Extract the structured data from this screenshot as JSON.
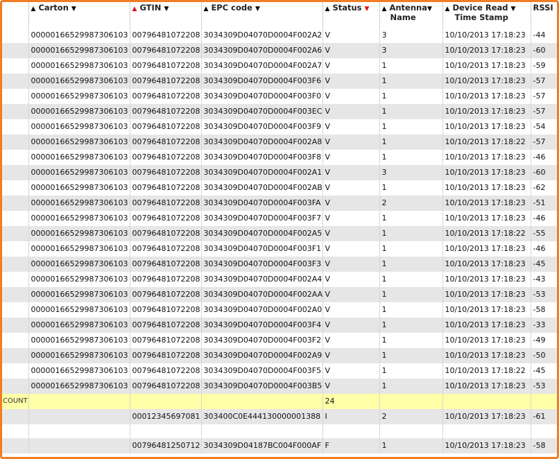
{
  "headers": {
    "carton": "Carton",
    "gtin": "GTIN",
    "epc": "EPC code",
    "status": "Status",
    "antenna_line1": "Antenna",
    "antenna_line2": "Name",
    "device_line1": "Device Read",
    "device_line2": "Time Stamp",
    "rssi": "RSSI"
  },
  "sort_indicators": {
    "up": "▲",
    "down": "▼",
    "active_color": "#d8141c"
  },
  "rows": [
    {
      "carton": "00000166529987306103",
      "gtin": "00796481072208",
      "epc": "3034309D04070D0004F002A2",
      "status": "V",
      "antenna": "3",
      "time": "10/10/2013 17:18:23",
      "rssi": "-44"
    },
    {
      "carton": "00000166529987306103",
      "gtin": "00796481072208",
      "epc": "3034309D04070D0004F002A6",
      "status": "V",
      "antenna": "3",
      "time": "10/10/2013 17:18:23",
      "rssi": "-60"
    },
    {
      "carton": "00000166529987306103",
      "gtin": "00796481072208",
      "epc": "3034309D04070D0004F002A7",
      "status": "V",
      "antenna": "1",
      "time": "10/10/2013 17:18:23",
      "rssi": "-59"
    },
    {
      "carton": "00000166529987306103",
      "gtin": "00796481072208",
      "epc": "3034309D04070D0004F003F6",
      "status": "V",
      "antenna": "1",
      "time": "10/10/2013 17:18:23",
      "rssi": "-57"
    },
    {
      "carton": "00000166529987306103",
      "gtin": "00796481072208",
      "epc": "3034309D04070D0004F003F0",
      "status": "V",
      "antenna": "1",
      "time": "10/10/2013 17:18:23",
      "rssi": "-57"
    },
    {
      "carton": "00000166529987306103",
      "gtin": "00796481072208",
      "epc": "3034309D04070D0004F003EC",
      "status": "V",
      "antenna": "1",
      "time": "10/10/2013 17:18:23",
      "rssi": "-57"
    },
    {
      "carton": "00000166529987306103",
      "gtin": "00796481072208",
      "epc": "3034309D04070D0004F003F9",
      "status": "V",
      "antenna": "1",
      "time": "10/10/2013 17:18:23",
      "rssi": "-54"
    },
    {
      "carton": "00000166529987306103",
      "gtin": "00796481072208",
      "epc": "3034309D04070D0004F002A8",
      "status": "V",
      "antenna": "1",
      "time": "10/10/2013 17:18:22",
      "rssi": "-57"
    },
    {
      "carton": "00000166529987306103",
      "gtin": "00796481072208",
      "epc": "3034309D04070D0004F003F8",
      "status": "V",
      "antenna": "1",
      "time": "10/10/2013 17:18:23",
      "rssi": "-46"
    },
    {
      "carton": "00000166529987306103",
      "gtin": "00796481072208",
      "epc": "3034309D04070D0004F002A1",
      "status": "V",
      "antenna": "3",
      "time": "10/10/2013 17:18:23",
      "rssi": "-60"
    },
    {
      "carton": "00000166529987306103",
      "gtin": "00796481072208",
      "epc": "3034309D04070D0004F002AB",
      "status": "V",
      "antenna": "1",
      "time": "10/10/2013 17:18:23",
      "rssi": "-62"
    },
    {
      "carton": "00000166529987306103",
      "gtin": "00796481072208",
      "epc": "3034309D04070D0004F003FA",
      "status": "V",
      "antenna": "2",
      "time": "10/10/2013 17:18:23",
      "rssi": "-51"
    },
    {
      "carton": "00000166529987306103",
      "gtin": "00796481072208",
      "epc": "3034309D04070D0004F003F7",
      "status": "V",
      "antenna": "1",
      "time": "10/10/2013 17:18:23",
      "rssi": "-46"
    },
    {
      "carton": "00000166529987306103",
      "gtin": "00796481072208",
      "epc": "3034309D04070D0004F002A5",
      "status": "V",
      "antenna": "1",
      "time": "10/10/2013 17:18:22",
      "rssi": "-55"
    },
    {
      "carton": "00000166529987306103",
      "gtin": "00796481072208",
      "epc": "3034309D04070D0004F003F1",
      "status": "V",
      "antenna": "1",
      "time": "10/10/2013 17:18:23",
      "rssi": "-46"
    },
    {
      "carton": "00000166529987306103",
      "gtin": "00796481072208",
      "epc": "3034309D04070D0004F003F3",
      "status": "V",
      "antenna": "1",
      "time": "10/10/2013 17:18:23",
      "rssi": "-45"
    },
    {
      "carton": "00000166529987306103",
      "gtin": "00796481072208",
      "epc": "3034309D04070D0004F002A4",
      "status": "V",
      "antenna": "1",
      "time": "10/10/2013 17:18:23",
      "rssi": "-43"
    },
    {
      "carton": "00000166529987306103",
      "gtin": "00796481072208",
      "epc": "3034309D04070D0004F002AA",
      "status": "V",
      "antenna": "1",
      "time": "10/10/2013 17:18:23",
      "rssi": "-53"
    },
    {
      "carton": "00000166529987306103",
      "gtin": "00796481072208",
      "epc": "3034309D04070D0004F002A0",
      "status": "V",
      "antenna": "1",
      "time": "10/10/2013 17:18:23",
      "rssi": "-58"
    },
    {
      "carton": "00000166529987306103",
      "gtin": "00796481072208",
      "epc": "3034309D04070D0004F003F4",
      "status": "V",
      "antenna": "1",
      "time": "10/10/2013 17:18:23",
      "rssi": "-33"
    },
    {
      "carton": "00000166529987306103",
      "gtin": "00796481072208",
      "epc": "3034309D04070D0004F003F2",
      "status": "V",
      "antenna": "1",
      "time": "10/10/2013 17:18:23",
      "rssi": "-49"
    },
    {
      "carton": "00000166529987306103",
      "gtin": "00796481072208",
      "epc": "3034309D04070D0004F002A9",
      "status": "V",
      "antenna": "1",
      "time": "10/10/2013 17:18:23",
      "rssi": "-50"
    },
    {
      "carton": "00000166529987306103",
      "gtin": "00796481072208",
      "epc": "3034309D04070D0004F003F5",
      "status": "V",
      "antenna": "1",
      "time": "10/10/2013 17:18:22",
      "rssi": "-45"
    },
    {
      "carton": "00000166529987306103",
      "gtin": "00796481072208",
      "epc": "3034309D04070D0004F003B5",
      "status": "V",
      "antenna": "1",
      "time": "10/10/2013 17:18:23",
      "rssi": "-53"
    }
  ],
  "count_row": {
    "label": "COUNT",
    "value": "24"
  },
  "extra_rows": [
    {
      "carton": "",
      "gtin": "00012345697081",
      "epc": "303400C0E444130000001388",
      "status": "I",
      "antenna": "2",
      "time": "10/10/2013 17:18:23",
      "rssi": "-61"
    },
    {
      "carton": "",
      "gtin": "",
      "epc": "",
      "status": "",
      "antenna": "",
      "time": "",
      "rssi": ""
    },
    {
      "carton": "",
      "gtin": "00796481250712",
      "epc": "3034309D04187BC004F000AF",
      "status": "F",
      "antenna": "1",
      "time": "10/10/2013 17:18:23",
      "rssi": "-58"
    }
  ]
}
